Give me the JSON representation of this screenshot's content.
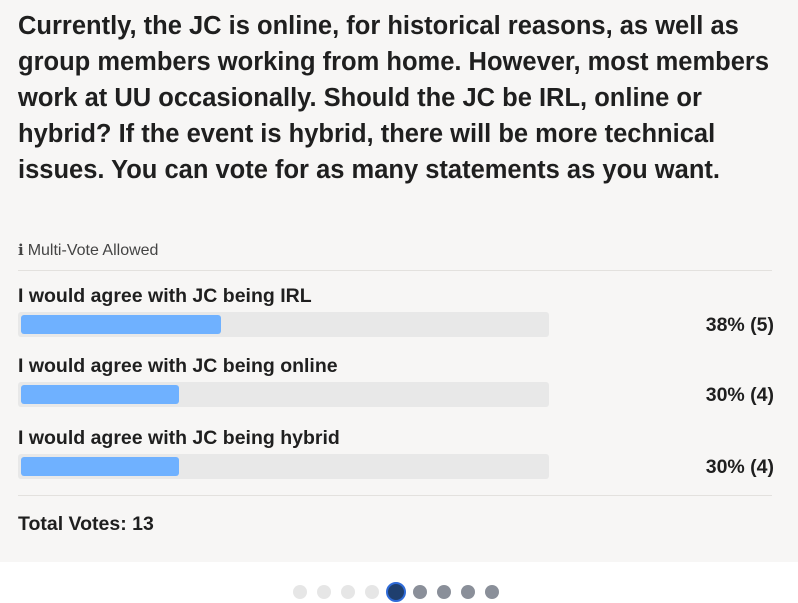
{
  "poll": {
    "question": "Currently, the JC is online, for historical reasons, as well as group members working from home. However, most members work at UU occasionally. Should the JC be IRL, online or hybrid? If the event is hybrid, there will be more technical issues. You can vote for as many statements as you want.",
    "info_icon": "i",
    "multivote_label": "Multi-Vote Allowed",
    "options": [
      {
        "label": "I would agree with JC being IRL",
        "percent": 38,
        "votes": 5,
        "result": "38% (5)"
      },
      {
        "label": "I would agree with JC being online",
        "percent": 30,
        "votes": 4,
        "result": "30% (4)"
      },
      {
        "label": "I would agree with JC being hybrid",
        "percent": 30,
        "votes": 4,
        "result": "30% (4)"
      }
    ],
    "total_label": "Total Votes: 13",
    "bar_color": "#6fb1ff",
    "track_color": "#e8e8e8"
  },
  "pagination": {
    "total": 9,
    "current": 5,
    "icon": "page-dot-icon"
  }
}
